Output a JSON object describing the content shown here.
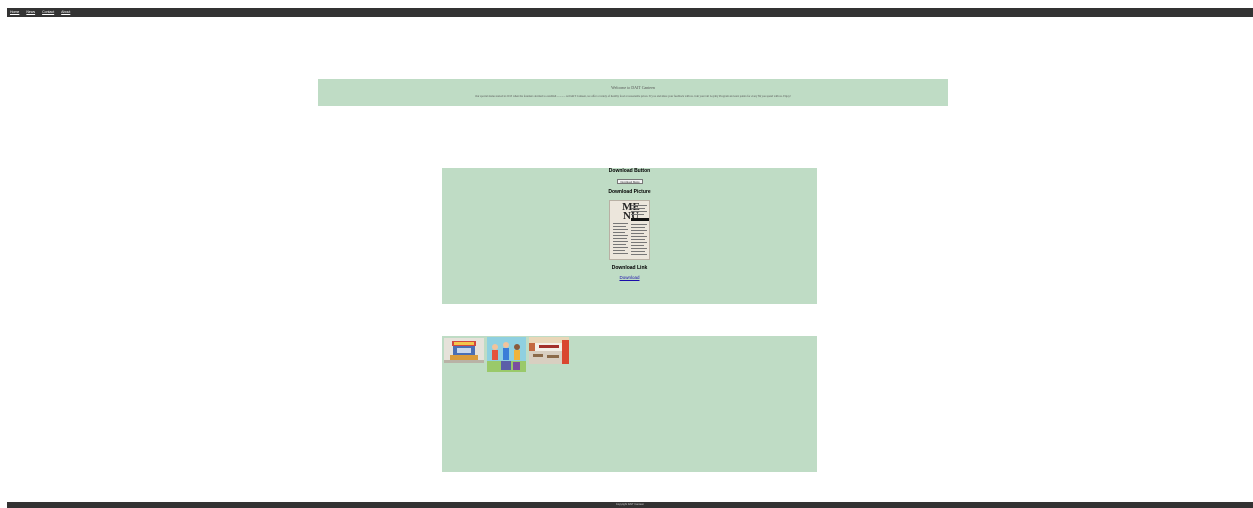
{
  "nav": {
    "items": [
      {
        "label": "Home"
      },
      {
        "label": "News"
      },
      {
        "label": "Contact"
      },
      {
        "label": "About"
      }
    ]
  },
  "welcome": {
    "title": "Welcome to DAIT Canteen",
    "description": "Our special menu started in 2015 when the founders decided to establish ............ At DAIT Canteen, we offer a variety of healthy food at reasonable prices. Try us and share your feedback with us. Join your tail Loyalty Program and earn points for every $$ you spend with us. Enjoy!"
  },
  "download_section": {
    "button_heading": "Download Button",
    "button_label": "Download Menu",
    "picture_heading": "Download Picture",
    "picture_text": "ME NU",
    "link_heading": "Download Link",
    "link_label": "Download"
  },
  "gallery": {
    "items": [
      {
        "name": "canteen-stall-picture"
      },
      {
        "name": "students-picture"
      },
      {
        "name": "canteen-interior-picture"
      }
    ]
  },
  "footer": {
    "text": "Copyright DAIT Canteen"
  },
  "colors": {
    "nav_bg": "#333333",
    "panel_bg": "#bfdcc5",
    "link": "#1a0dab"
  }
}
